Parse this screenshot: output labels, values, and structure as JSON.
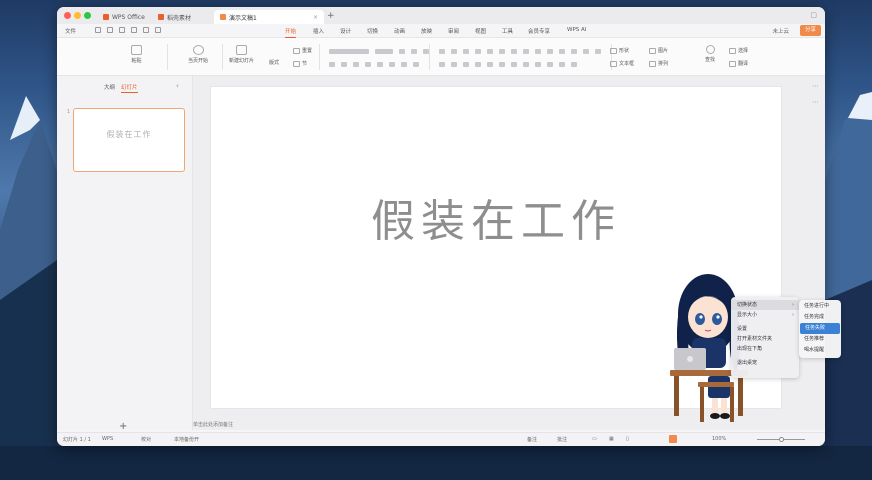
{
  "titlebar": {
    "tabs": [
      {
        "label": "WPS Office",
        "color": "#e8602d"
      },
      {
        "label": "稻壳素材",
        "color": "#e8602d"
      },
      {
        "label": "演示文稿1",
        "color": "#f08a4b",
        "close": "×"
      }
    ],
    "new_tab": "+"
  },
  "menubar": {
    "file": "文件",
    "items": [
      "开始",
      "插入",
      "设计",
      "切换",
      "动画",
      "放映",
      "审阅",
      "视图",
      "工具",
      "会员专享",
      "WPS AI"
    ],
    "active": "开始",
    "unsaved": "未上云",
    "share": "分享"
  },
  "ribbon": {
    "paste": "粘贴",
    "from_current": "当页开始",
    "new_slide": "新建幻灯片",
    "layout": "版式",
    "reset": "重置",
    "section": "节",
    "shape": "形状",
    "textbox": "文本框",
    "picture": "图片",
    "arrange": "排列",
    "find": "查找",
    "select": "选择",
    "translate": "翻译"
  },
  "left_panel": {
    "tabs": [
      "大纲",
      "幻灯片"
    ],
    "active_tab": "幻灯片",
    "slide_number": "1",
    "thumb_title": "假装在工作",
    "add_label": "+"
  },
  "slide": {
    "title": "假装在工作"
  },
  "notes_tab": "单击此处添加备注",
  "statusbar": {
    "slide_info": "幻灯片 1 / 1",
    "theme": "WPS",
    "proofread": "校对",
    "backup": "本地备份开",
    "notes": "备注",
    "comment": "批注",
    "zoom": "100%"
  },
  "context_menu": {
    "items": [
      {
        "label": "切换状态",
        "submenu": true,
        "highlighted": true
      },
      {
        "label": "显示大小",
        "submenu": true
      },
      {
        "label": "设置"
      },
      {
        "label": "打开素材文件夹"
      },
      {
        "label": "出现在下角"
      },
      {
        "label": "退出桌宠"
      }
    ],
    "submenu": [
      {
        "label": "任务进行中"
      },
      {
        "label": "任务完成"
      },
      {
        "label": "任务失败",
        "selected": true
      },
      {
        "label": "任务推荐"
      },
      {
        "label": "喝水提醒"
      }
    ]
  }
}
